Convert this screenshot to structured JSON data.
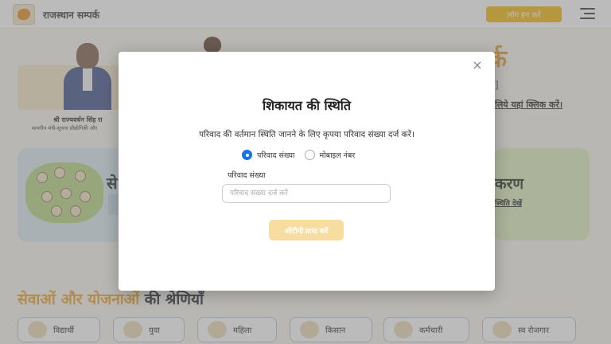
{
  "header": {
    "site_title": "राजस्थान सम्पर्क",
    "login_label": "लॉग इन करें",
    "logo_icon": "rajasthan-logo-icon",
    "menu_icon": "hamburger-menu-icon"
  },
  "background": {
    "minister_name": "श्री राज्यवर्धन सिंह रा",
    "minister_role": "माननीय मंत्री-सूचना प्रौद्योगिकी और",
    "heading_fragment": "र्क",
    "bracket_text": "]",
    "right_link": "लिये यहां क्लिक करें।",
    "services_card_title": "से",
    "right_card_title": "करण",
    "right_card_link": "स्थिति देखें",
    "categories_title_accent": "सेवाओं और योजनाओं",
    "categories_title_dark": "की श्रेणियाँ",
    "categories": [
      {
        "label": "विद्यार्थी",
        "icon": "student-icon"
      },
      {
        "label": "युवा",
        "icon": "youth-icon"
      },
      {
        "label": "महिला",
        "icon": "woman-icon"
      },
      {
        "label": "किसान",
        "icon": "farmer-icon"
      },
      {
        "label": "कर्मचारी",
        "icon": "employee-icon"
      },
      {
        "label": "स्व रोजगार",
        "icon": "self-employment-icon"
      }
    ]
  },
  "modal": {
    "close_glyph": "×",
    "title": "शिकायत की स्थिति",
    "description": "परिवाद की वर्तमान स्थिति जानने के लिए कृपया परिवाद संख्या दर्ज करें।",
    "radio_options": [
      {
        "label": "परिवाद संख्या",
        "selected": true
      },
      {
        "label": "मोबाइल नंबर",
        "selected": false
      }
    ],
    "field_label": "परिवाद संख्या",
    "field_placeholder": "परिवाद संख्या दर्ज करें",
    "field_value": "",
    "submit_label": "ओटीपी प्राप्त करें"
  },
  "colors": {
    "accent_yellow": "#f2b705",
    "radio_blue": "#1a73e8",
    "heading_orange": "#e8a227"
  }
}
